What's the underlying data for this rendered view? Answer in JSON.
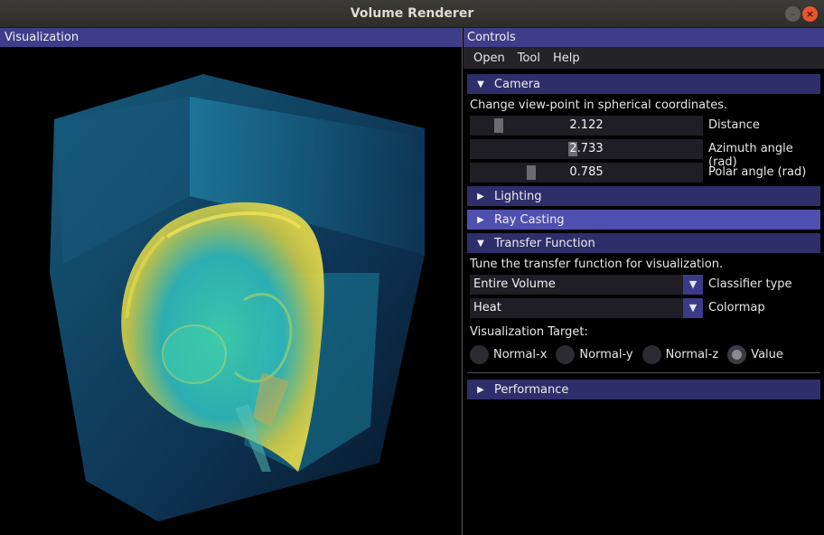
{
  "window": {
    "title": "Volume Renderer"
  },
  "visualization": {
    "header": "Visualization"
  },
  "controls": {
    "header": "Controls",
    "menu": [
      "Open",
      "Tool",
      "Help"
    ],
    "camera": {
      "title": "Camera",
      "description": "Change view-point in spherical coordinates.",
      "sliders": [
        {
          "label": "Distance",
          "value": "2.122"
        },
        {
          "label": "Azimuth angle (rad)",
          "value": "2.733"
        },
        {
          "label": "Polar angle (rad)",
          "value": "0.785"
        }
      ]
    },
    "lighting": {
      "title": "Lighting"
    },
    "ray_casting": {
      "title": "Ray Casting"
    },
    "transfer_function": {
      "title": "Transfer Function",
      "description": "Tune the transfer function for visualization.",
      "classifier": {
        "value": "Entire Volume",
        "label": "Classifier type"
      },
      "colormap": {
        "value": "Heat",
        "label": "Colormap"
      },
      "target_label": "Visualization Target:",
      "targets": [
        "Normal-x",
        "Normal-y",
        "Normal-z",
        "Value"
      ],
      "selected_target": "Value"
    },
    "performance": {
      "title": "Performance"
    }
  }
}
